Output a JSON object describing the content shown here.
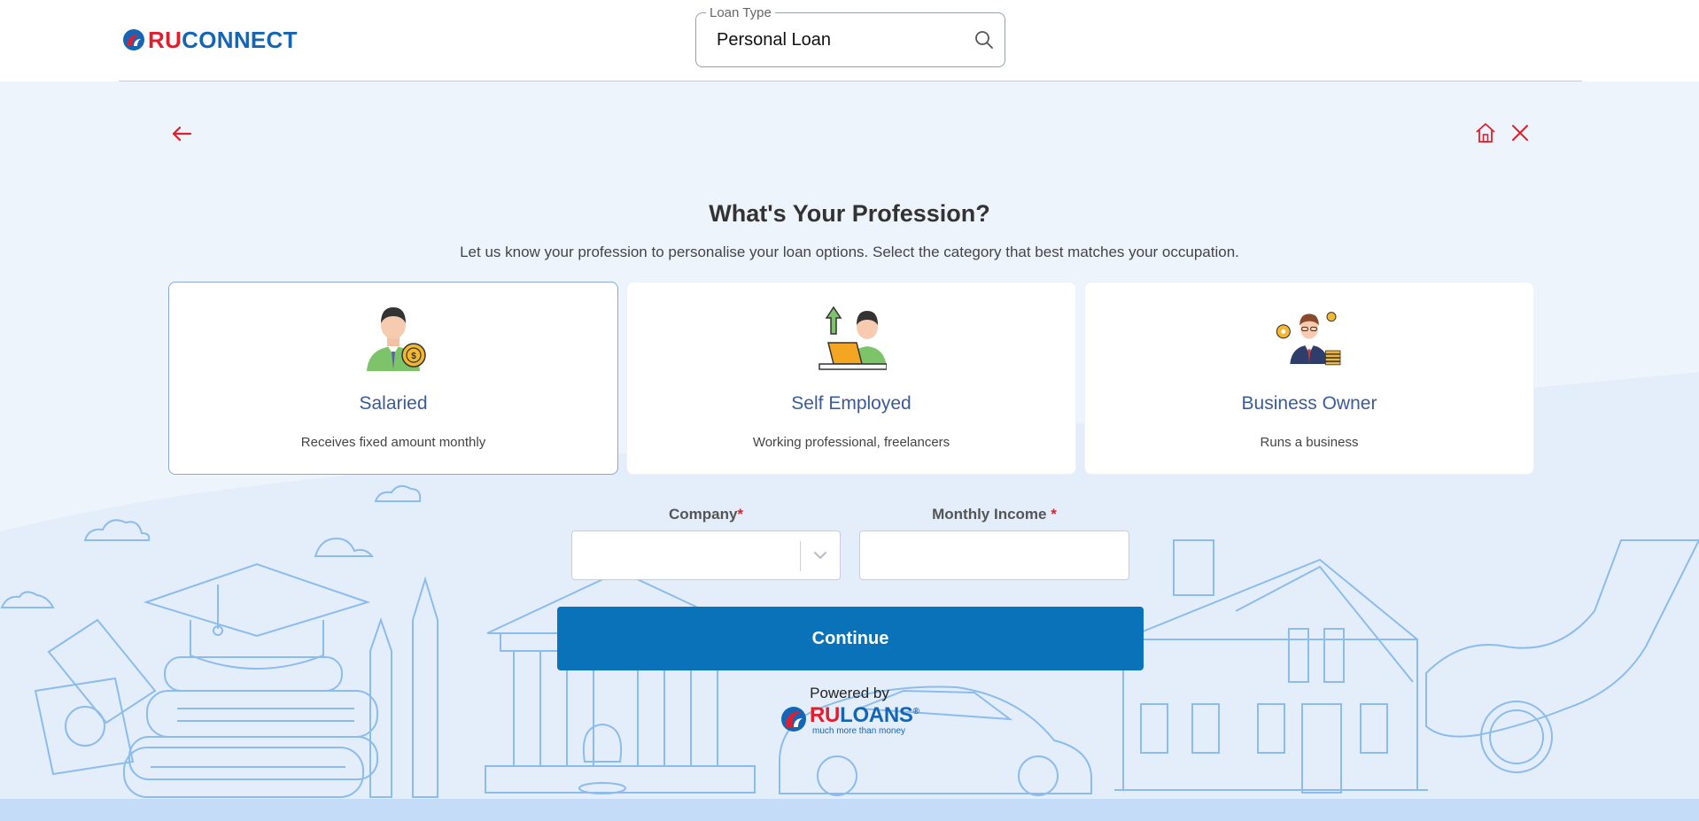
{
  "header": {
    "logo_ru": "RU",
    "logo_connect": "CONNECT",
    "loan_type_label": "Loan Type",
    "loan_type_value": "Personal Loan"
  },
  "page": {
    "title": "What's Your Profession?",
    "subtitle": "Let us know your profession to personalise your loan options. Select the category that best matches your occupation."
  },
  "professions": [
    {
      "title": "Salaried",
      "description": "Receives fixed amount monthly",
      "icon": "salaried-person-icon",
      "selected": true
    },
    {
      "title": "Self Employed",
      "description": "Working professional, freelancers",
      "icon": "self-employed-laptop-icon",
      "selected": false
    },
    {
      "title": "Business Owner",
      "description": "Runs a business",
      "icon": "business-owner-icon",
      "selected": false
    }
  ],
  "form": {
    "company_label": "Company",
    "income_label": "Monthly Income",
    "required_mark": "*",
    "company_value": "",
    "income_value": ""
  },
  "actions": {
    "continue_label": "Continue"
  },
  "footer": {
    "powered_by": "Powered by",
    "ruloans_ru": "RU",
    "ruloans_loans": "LOANS",
    "ruloans_reg": "®",
    "ruloans_tagline": "much more than money"
  },
  "colors": {
    "brand_red": "#e21e2c",
    "brand_blue": "#1565b5",
    "button_blue": "#0a72b9",
    "card_title": "#3b5b97",
    "background": "#eef4fc"
  }
}
